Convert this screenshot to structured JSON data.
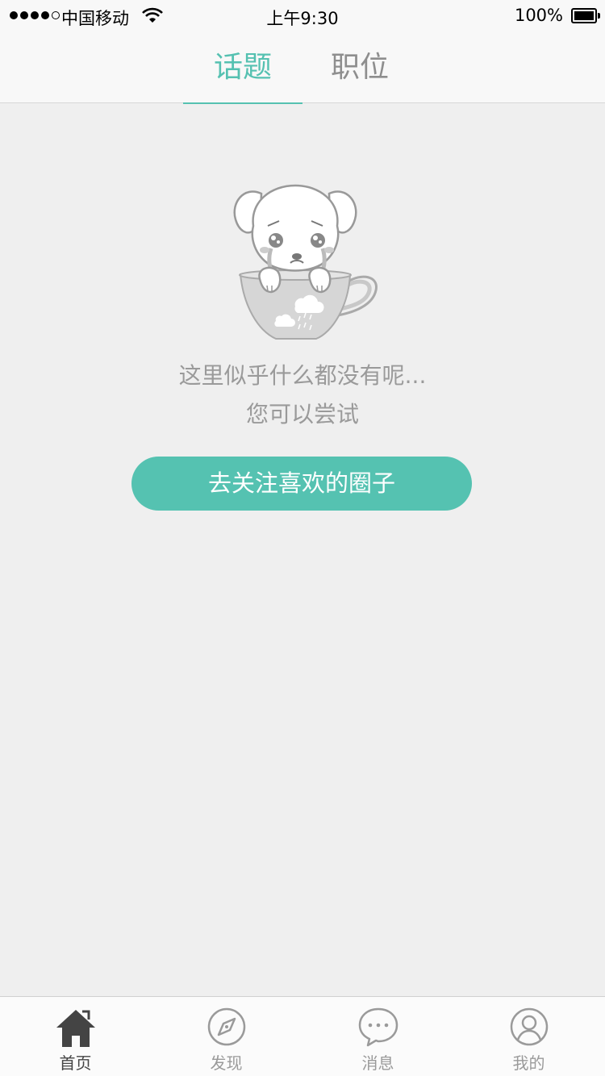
{
  "status_bar": {
    "carrier": "中国移动",
    "time": "上午9:30",
    "battery": "100%"
  },
  "tabs": [
    {
      "label": "话题",
      "active": true
    },
    {
      "label": "职位",
      "active": false
    }
  ],
  "empty_state": {
    "illustration": "crying-puppy-in-teacup",
    "line1": "这里似乎什么都没有呢...",
    "line2": "您可以尝试",
    "button": "去关注喜欢的圈子"
  },
  "bottom_nav": [
    {
      "label": "首页",
      "icon": "home-icon",
      "active": true
    },
    {
      "label": "发现",
      "icon": "compass-icon",
      "active": false
    },
    {
      "label": "消息",
      "icon": "chat-bubble-icon",
      "active": false
    },
    {
      "label": "我的",
      "icon": "user-icon",
      "active": false
    }
  ],
  "colors": {
    "accent": "#55c1b1",
    "background": "#efefef",
    "inactive": "#9a9a9a"
  }
}
